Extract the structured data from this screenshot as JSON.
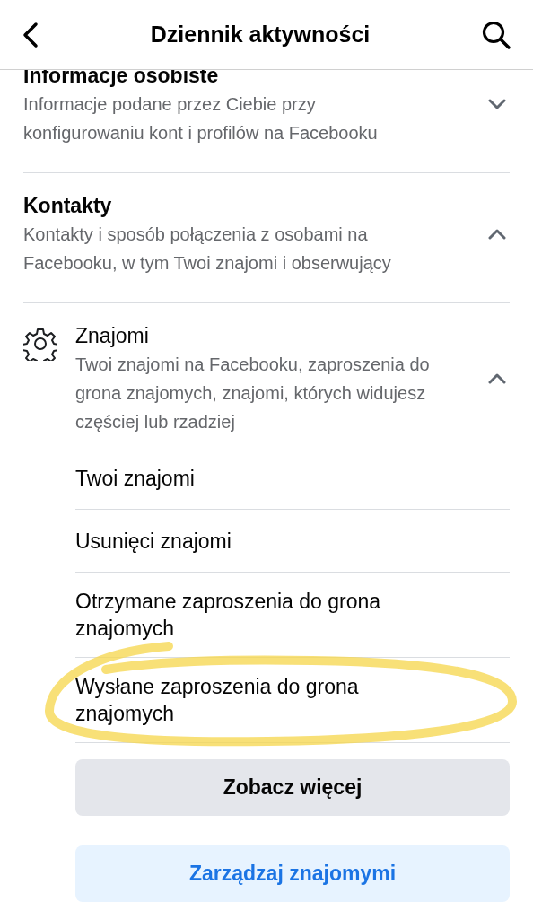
{
  "header": {
    "title": "Dziennik aktywności"
  },
  "sections": [
    {
      "kind": "plain",
      "title": "Informacje osobiste",
      "description": "Informacje podane przez Ciebie przy konfigurowaniu kont i profilów na Facebooku",
      "expanded": false
    },
    {
      "kind": "plain",
      "title": "Kontakty",
      "description": "Kontakty i sposób połączenia z osobami na Facebooku, w tym Twoi znajomi i obserwujący",
      "expanded": true
    },
    {
      "kind": "settings",
      "title": "Znajomi",
      "description": "Twoi znajomi na Facebooku, zaproszenia do grona znajomych, znajomi, których widujesz częściej lub rzadziej",
      "expanded": true,
      "children": [
        {
          "label": "Twoi znajomi"
        },
        {
          "label": "Usunięci znajomi"
        },
        {
          "label": "Otrzymane zaproszenia do grona znajomych"
        },
        {
          "label": "Wysłane zaproszenia do grona znajomych"
        }
      ],
      "buttons": [
        {
          "kind": "secondary",
          "label": "Zobacz więcej"
        },
        {
          "kind": "primary",
          "label": "Zarządzaj znajomymi"
        }
      ]
    }
  ]
}
